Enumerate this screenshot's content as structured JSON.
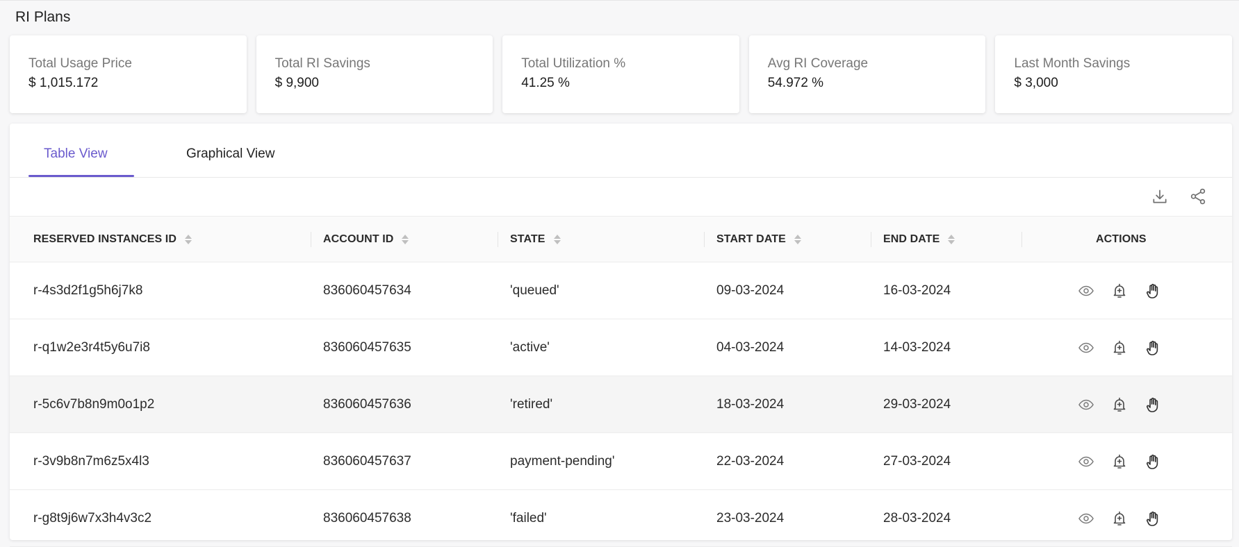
{
  "page": {
    "title": "RI Plans"
  },
  "summary_cards": [
    {
      "label": "Total Usage Price",
      "value": "$ 1,015.172"
    },
    {
      "label": "Total RI Savings",
      "value": "$ 9,900"
    },
    {
      "label": "Total Utilization %",
      "value": "41.25 %"
    },
    {
      "label": "Avg RI Coverage",
      "value": "54.972 %"
    },
    {
      "label": "Last Month Savings",
      "value": "$ 3,000"
    }
  ],
  "tabs": [
    {
      "label": "Table View",
      "active": true
    },
    {
      "label": "Graphical View",
      "active": false
    }
  ],
  "toolbar": {
    "download_icon": "download-icon",
    "share_icon": "share-icon"
  },
  "table": {
    "columns": [
      "RESERVED INSTANCES ID",
      "ACCOUNT ID",
      "STATE",
      "START DATE",
      "END DATE",
      "ACTIONS"
    ],
    "rows": [
      [
        "r-4s3d2f1g5h6j7k8",
        "836060457634",
        "'queued'",
        "09-03-2024",
        "16-03-2024"
      ],
      [
        "r-q1w2e3r4t5y6u7i8",
        "836060457635",
        "'active'",
        "04-03-2024",
        "14-03-2024"
      ],
      [
        "r-5c6v7b8n9m0o1p2",
        "836060457636",
        "'retired'",
        "18-03-2024",
        "29-03-2024"
      ],
      [
        "r-3v9b8n7m6z5x4l3",
        "836060457637",
        "payment-pending'",
        "22-03-2024",
        "27-03-2024"
      ],
      [
        "r-g8t9j6w7x3h4v3c2",
        "836060457638",
        "'failed'",
        "23-03-2024",
        "28-03-2024"
      ]
    ],
    "row_actions": [
      "eye-icon",
      "bell-plus-icon",
      "hand-icon"
    ]
  },
  "colors": {
    "accent": "#6a5acd",
    "background": "#f7f7f8",
    "card": "#ffffff",
    "muted_text": "#777777",
    "icon": "#757575",
    "row_hover": "#f5f5f5"
  }
}
